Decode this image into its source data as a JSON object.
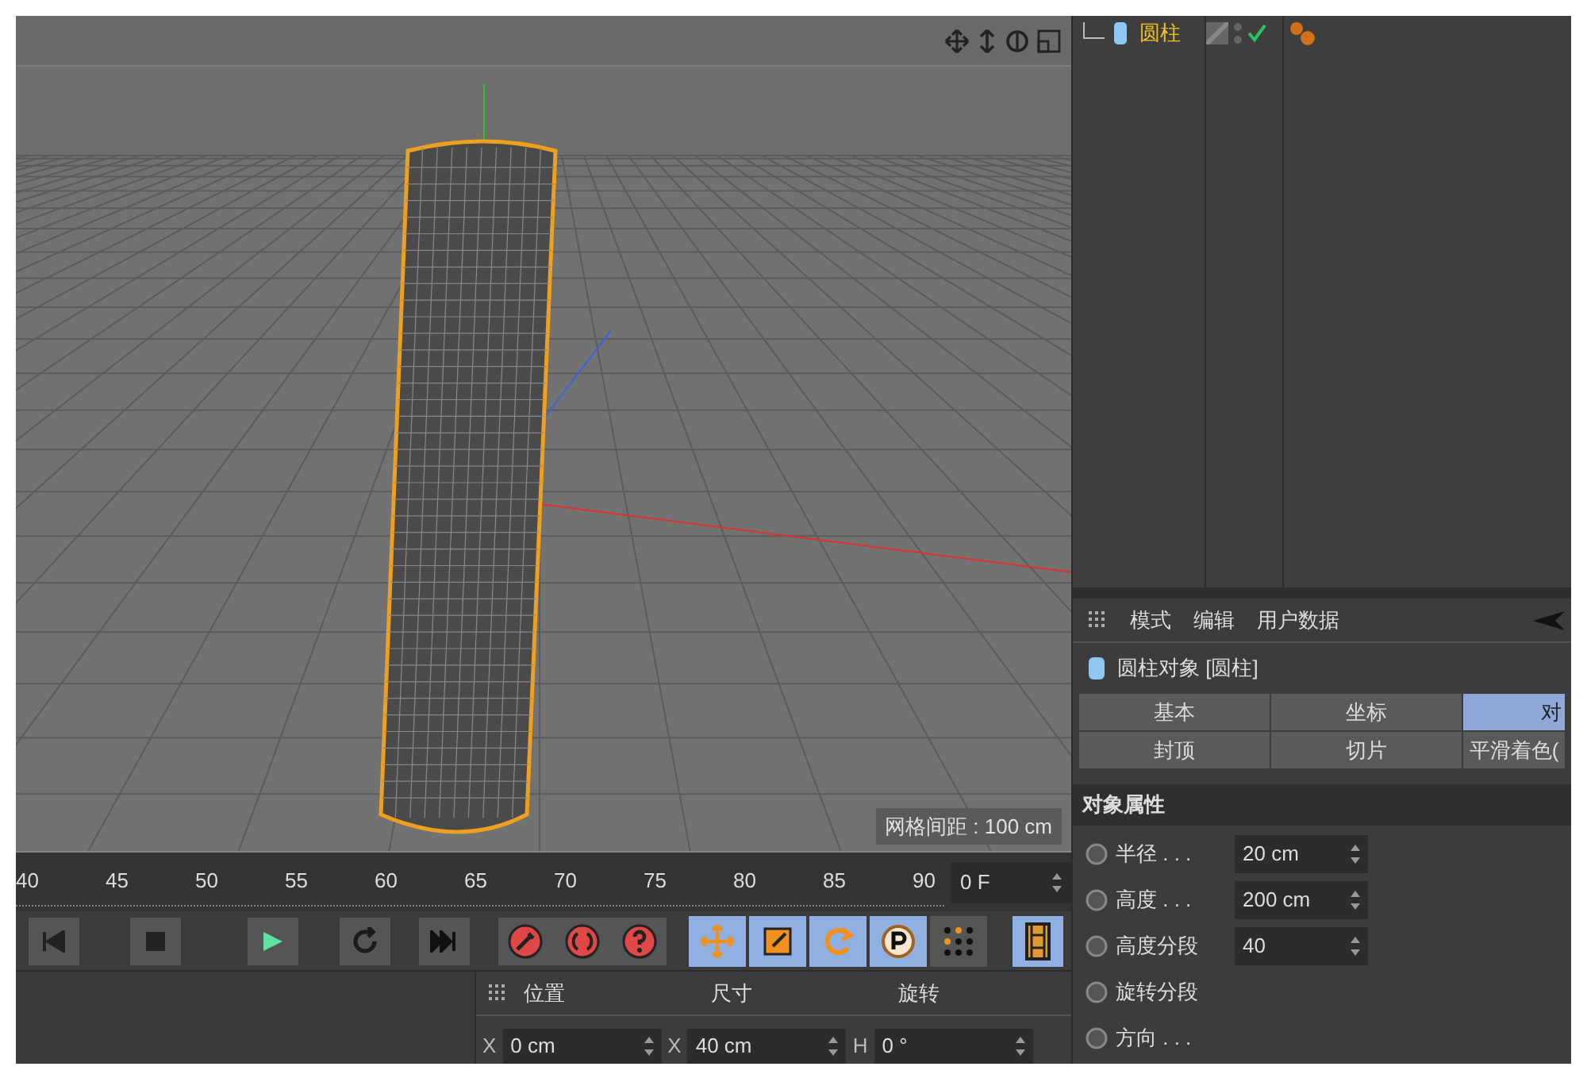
{
  "viewport": {
    "grid_spacing": "网格间距 : 100 cm"
  },
  "timeline": {
    "ticks": [
      "40",
      "45",
      "50",
      "55",
      "60",
      "65",
      "70",
      "75",
      "80",
      "85",
      "90"
    ],
    "frame": "0 F"
  },
  "tools": [
    {
      "kind": "move",
      "selected": true
    },
    {
      "kind": "scale",
      "selected": true
    },
    {
      "kind": "rotate",
      "selected": true
    },
    {
      "kind": "point",
      "selected": true
    },
    {
      "kind": "dots",
      "selected": false
    }
  ],
  "object_manager": {
    "objects": [
      {
        "name": "圆柱",
        "enabled": true
      }
    ]
  },
  "attributes": {
    "menu": [
      "模式",
      "编辑",
      "用户数据"
    ],
    "object_title": "圆柱对象 [圆柱]",
    "tabs": [
      {
        "label": "基本",
        "selected": false
      },
      {
        "label": "坐标",
        "selected": false
      },
      {
        "label": "对",
        "selected": true
      },
      {
        "label": "封顶",
        "selected": false
      },
      {
        "label": "切片",
        "selected": false
      },
      {
        "label": "平滑着色(",
        "selected": false
      }
    ],
    "section": "对象属性",
    "fields": [
      {
        "label": "半径 . . .",
        "value": "20 cm"
      },
      {
        "label": "高度 . . .",
        "value": "200 cm"
      },
      {
        "label": "高度分段",
        "value": "40"
      },
      {
        "label": "旋转分段"
      },
      {
        "label": "方向 . . ."
      }
    ]
  },
  "coordinates": {
    "headers": [
      "位置",
      "尺寸",
      "旋转"
    ],
    "fields": [
      {
        "axis": "X",
        "value": "0 cm"
      },
      {
        "axis": "X",
        "value": "40 cm"
      },
      {
        "axis": "H",
        "value": "0 °"
      }
    ]
  }
}
